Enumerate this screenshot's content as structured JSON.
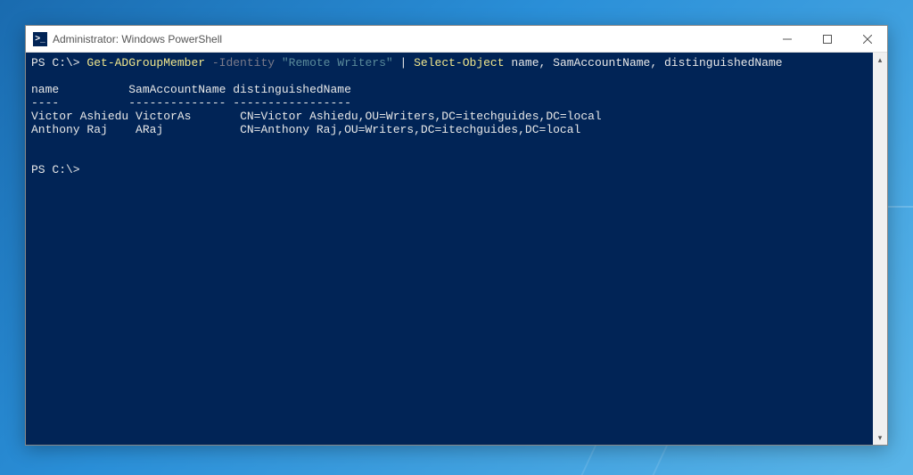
{
  "window": {
    "title": "Administrator: Windows PowerShell",
    "icon_glyph": ">_"
  },
  "terminal": {
    "prompt1_ps": "PS C:\\> ",
    "cmd1_cmdlet": "Get-ADGroupMember",
    "cmd1_param": " -Identity ",
    "cmd1_arg": "\"Remote Writers\"",
    "cmd1_pipe": " | ",
    "cmd1_cmdlet2": "Select-Object",
    "cmd1_cols": " name, SamAccountName, distinguishedName",
    "blank": "",
    "hdr_name": "name          ",
    "hdr_sam": "SamAccountName ",
    "hdr_dn": "distinguishedName",
    "sep_name": "----          ",
    "sep_sam": "-------------- ",
    "sep_dn": "-----------------",
    "row1_name": "Victor Ashiedu ",
    "row1_sam": "VictorAs       ",
    "row1_dn": "CN=Victor Ashiedu,OU=Writers,DC=itechguides,DC=local",
    "row2_name": "Anthony Raj    ",
    "row2_sam": "ARaj           ",
    "row2_dn": "CN=Anthony Raj,OU=Writers,DC=itechguides,DC=local",
    "prompt2": "PS C:\\>"
  }
}
